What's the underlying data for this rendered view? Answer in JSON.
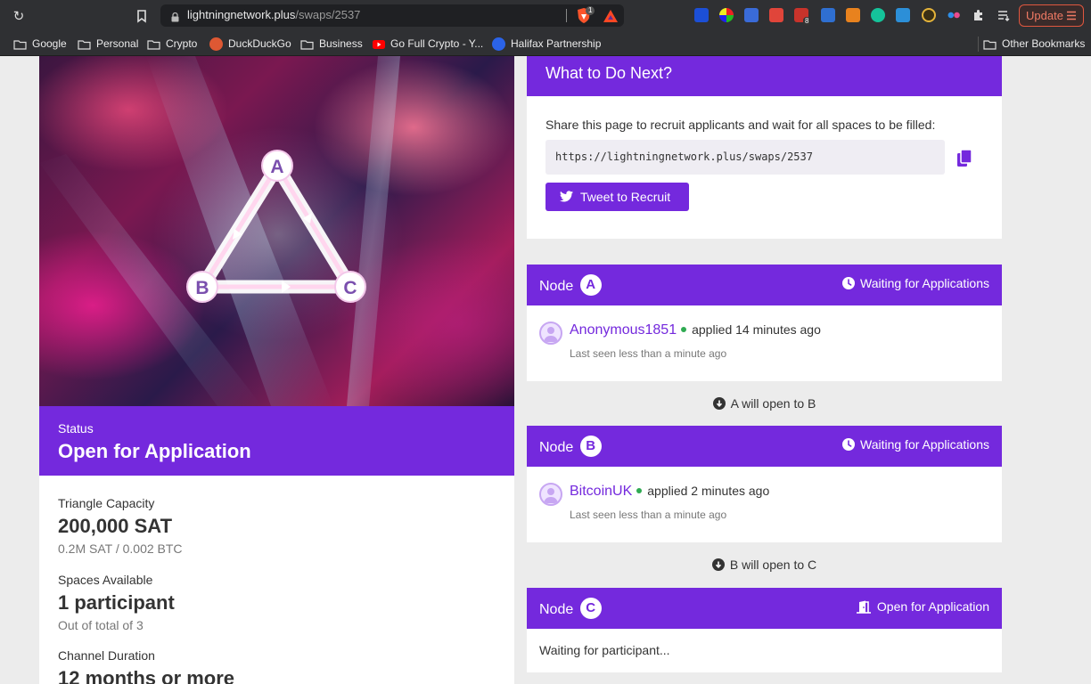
{
  "browser": {
    "url_host": "lightningnetwork.plus",
    "url_path": "/swaps/2537",
    "brave_badge": "1",
    "ext_badge": "8",
    "update_label": "Update",
    "bookmarks": [
      "Google",
      "Personal",
      "Crypto",
      "DuckDuckGo",
      "Business",
      "Go Full Crypto - Y...",
      "Halifax Partnership"
    ],
    "other_bookmarks": "Other Bookmarks"
  },
  "hero": {
    "vertex_a": "A",
    "vertex_b": "B",
    "vertex_c": "C"
  },
  "status": {
    "label": "Status",
    "value": "Open for Application"
  },
  "details": {
    "capacity_label": "Triangle Capacity",
    "capacity_value": "200,000 SAT",
    "capacity_sub": "0.2M SAT / 0.002 BTC",
    "spaces_label": "Spaces Available",
    "spaces_value": "1 participant",
    "spaces_sub": "Out of total of 3",
    "duration_label": "Channel Duration",
    "duration_value": "12 months or more"
  },
  "next": {
    "title": "What to Do Next?",
    "share_text": "Share this page to recruit applicants and wait for all spaces to be filled:",
    "share_url": "https://lightningnetwork.plus/swaps/2537",
    "tweet_label": "Tweet to Recruit"
  },
  "nodes": [
    {
      "prefix": "Node",
      "letter": "A",
      "status": "Waiting for Applications",
      "applicant_name": "Anonymous1851",
      "applied": "applied 14 minutes ago",
      "last_seen": "Last seen less than a minute ago"
    },
    {
      "prefix": "Node",
      "letter": "B",
      "status": "Waiting for Applications",
      "applicant_name": "BitcoinUK",
      "applied": "applied 2 minutes ago",
      "last_seen": "Last seen less than a minute ago"
    },
    {
      "prefix": "Node",
      "letter": "C",
      "status": "Open for Application",
      "waiting_text": "Waiting for participant..."
    }
  ],
  "connectors": [
    "A will open to B",
    "B will open to C"
  ],
  "colors": {
    "brand_purple": "#7429dd",
    "online_green": "#2faa52",
    "update_orange": "#e0573f"
  }
}
